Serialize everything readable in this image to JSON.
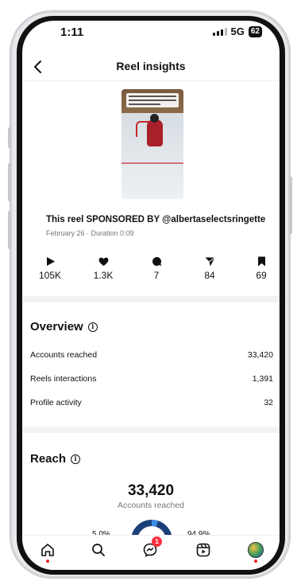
{
  "status_bar": {
    "time": "1:11",
    "network": "5G",
    "battery": "62"
  },
  "header": {
    "title": "Reel insights"
  },
  "reel": {
    "title": "This reel SPONSORED BY @albertaselectsringette",
    "meta": "February 26 · Duration 0:09"
  },
  "stats": [
    {
      "icon": "play-icon",
      "value": "105K"
    },
    {
      "icon": "heart-icon",
      "value": "1.3K"
    },
    {
      "icon": "comment-icon",
      "value": "7"
    },
    {
      "icon": "share-icon",
      "value": "84"
    },
    {
      "icon": "bookmark-icon",
      "value": "69"
    }
  ],
  "overview": {
    "title": "Overview",
    "rows": [
      {
        "label": "Accounts reached",
        "value": "33,420"
      },
      {
        "label": "Reels interactions",
        "value": "1,391"
      },
      {
        "label": "Profile activity",
        "value": "32"
      }
    ]
  },
  "reach": {
    "title": "Reach",
    "total": "33,420",
    "subtitle": "Accounts reached",
    "left_pct": "5.0%",
    "right_pct": "94.9%"
  },
  "tabbar": {
    "messages_badge": "1",
    "items": [
      "home-icon",
      "search-icon",
      "messenger-icon",
      "reels-icon",
      "profile-avatar"
    ]
  },
  "colors": {
    "accent_blue": "#0f5fd1",
    "reach_dark": "#1b3f7a",
    "badge_red": "#ff3040"
  }
}
